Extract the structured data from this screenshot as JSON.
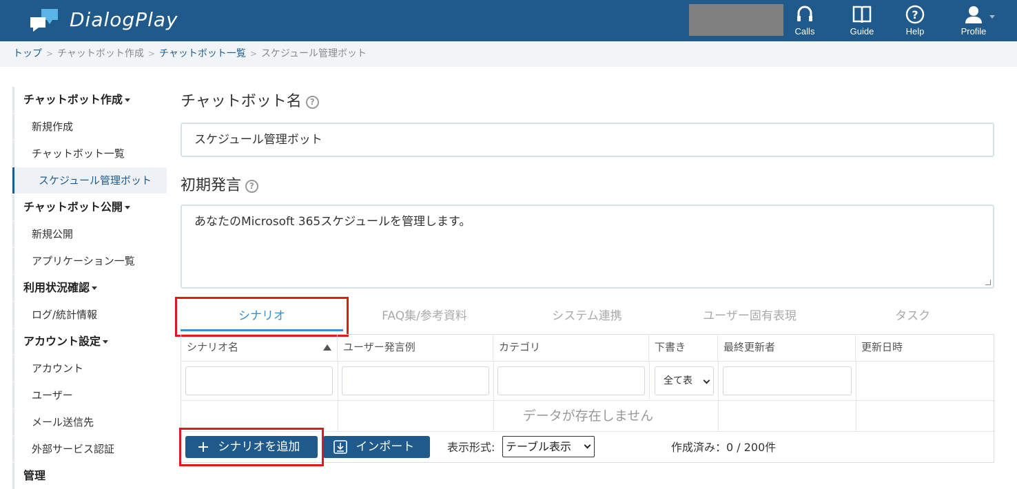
{
  "header": {
    "brand": "DialogPlay",
    "nav": [
      {
        "label": "Calls",
        "icon": "headset-icon"
      },
      {
        "label": "Guide",
        "icon": "book-icon"
      },
      {
        "label": "Help",
        "icon": "question-icon"
      },
      {
        "label": "Profile",
        "icon": "user-icon"
      }
    ]
  },
  "breadcrumb": {
    "items": [
      "トップ",
      "チャットボット作成",
      "チャットボット一覧",
      "スケジュール管理ボット"
    ],
    "separator": ">"
  },
  "sidebar": {
    "groups": [
      {
        "label": "チャットボット作成",
        "items": [
          "新規作成",
          "チャットボット一覧",
          "スケジュール管理ボット"
        ]
      },
      {
        "label": "チャットボット公開",
        "items": [
          "新規公開",
          "アプリケーション一覧"
        ]
      },
      {
        "label": "利用状況確認",
        "items": [
          "ログ/統計情報"
        ]
      },
      {
        "label": "アカウント設定",
        "items": [
          "アカウント",
          "ユーザー",
          "メール送信先",
          "外部サービス認証"
        ]
      },
      {
        "label": "管理",
        "items": []
      }
    ],
    "active_item": "スケジュール管理ボット"
  },
  "form": {
    "name_label": "チャットボット名",
    "name_value": "スケジュール管理ボット",
    "greeting_label": "初期発言",
    "greeting_value": "あなたのMicrosoft 365スケジュールを管理します。",
    "help_glyph": "?"
  },
  "tabs": [
    "シナリオ",
    "FAQ集/参考資料",
    "システム連携",
    "ユーザー固有表現",
    "タスク"
  ],
  "active_tab": "シナリオ",
  "table": {
    "columns": [
      "シナリオ名",
      "ユーザー発言例",
      "カテゴリ",
      "下書き",
      "最終更新者",
      "更新日時"
    ],
    "draft_filter": "全て表",
    "empty_message": "データが存在しません"
  },
  "actions": {
    "add_label": "シナリオを追加",
    "import_label": "インポート",
    "format_label": "表示形式:",
    "format_value": "テーブル表示",
    "count_text": "作成済み：0 / 200件"
  },
  "colors": {
    "header_bg": "#1f5a8b",
    "accent": "#3a8fd1",
    "highlight_red": "#e0191f"
  }
}
